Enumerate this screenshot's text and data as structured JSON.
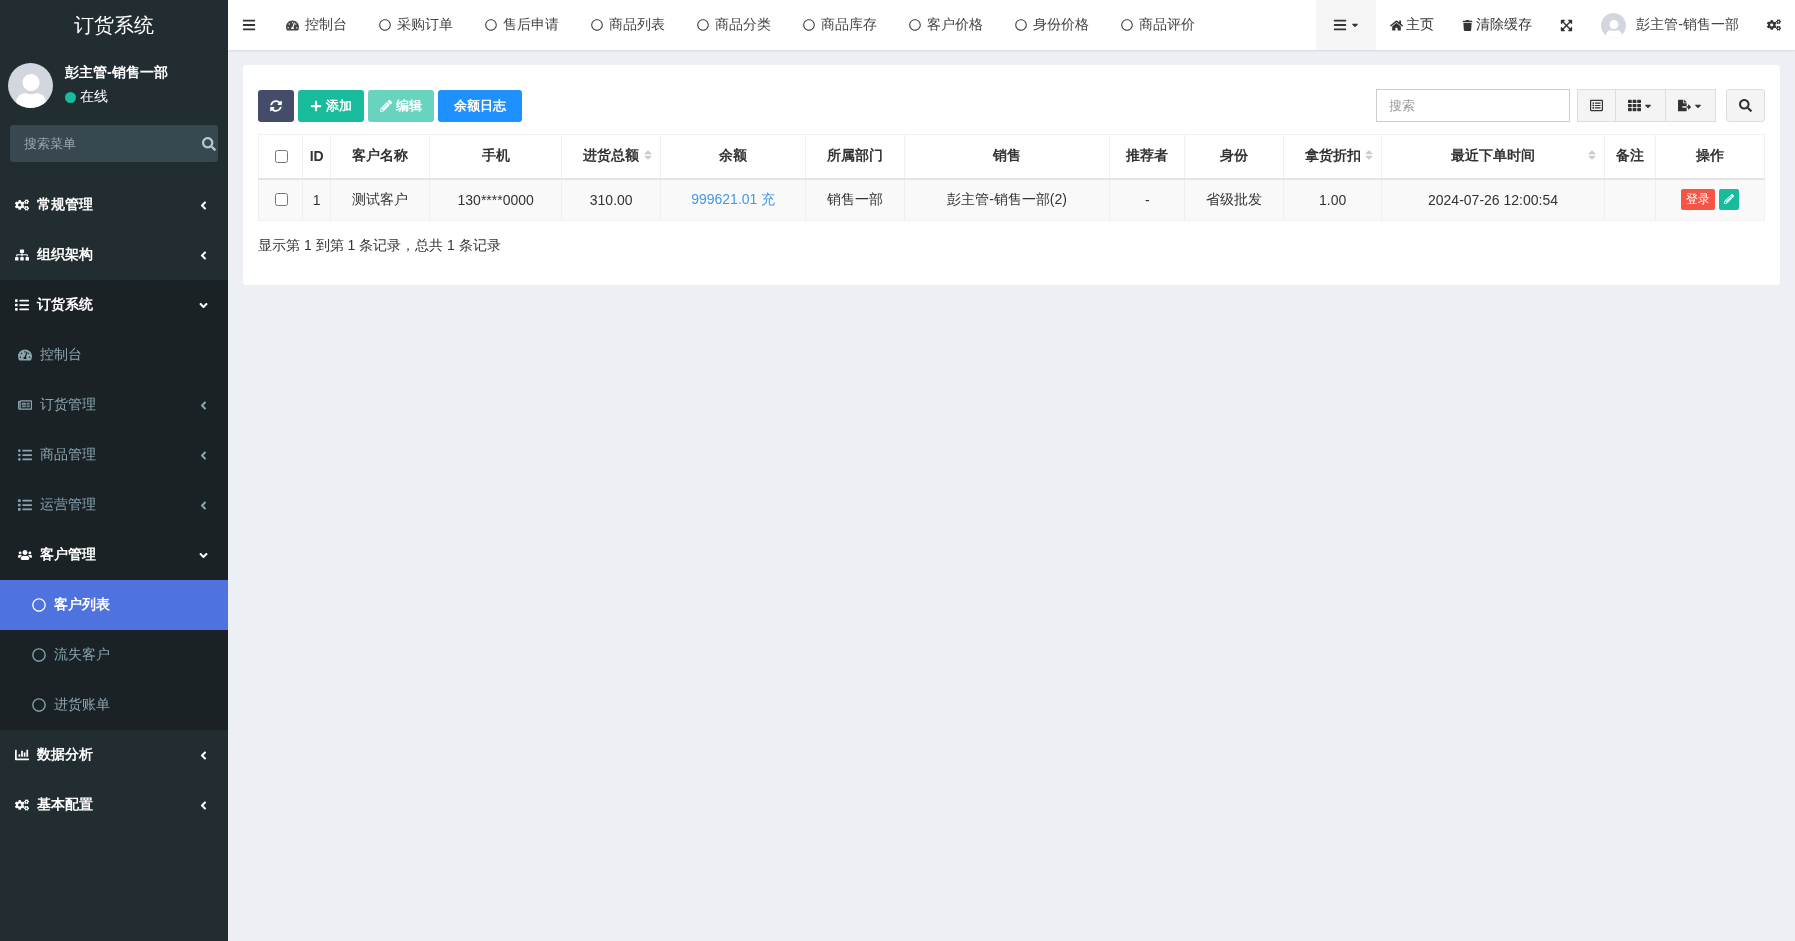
{
  "sidebar": {
    "title": "订货系统",
    "user": {
      "name": "彭主管-销售一部",
      "status": "在线",
      "online": true
    },
    "search": {
      "placeholder": "搜索菜单"
    },
    "menu": [
      {
        "label": "常规管理",
        "expanded": false
      },
      {
        "label": "组织架构",
        "expanded": false
      },
      {
        "label": "订货系统",
        "expanded": true,
        "children": [
          {
            "label": "控制台"
          },
          {
            "label": "订货管理",
            "expanded": false
          },
          {
            "label": "商品管理",
            "expanded": false
          },
          {
            "label": "运营管理",
            "expanded": false
          },
          {
            "label": "客户管理",
            "expanded": true,
            "children": [
              {
                "label": "客户列表",
                "selected": true
              },
              {
                "label": "流失客户",
                "selected": false
              },
              {
                "label": "进货账单",
                "selected": false
              }
            ]
          }
        ]
      },
      {
        "label": "数据分析",
        "expanded": false
      },
      {
        "label": "基本配置",
        "expanded": false
      }
    ]
  },
  "navbar": {
    "tabs": [
      {
        "label": "控制台",
        "kind": "dashboard"
      },
      {
        "label": "采购订单",
        "kind": "page"
      },
      {
        "label": "售后申请",
        "kind": "page"
      },
      {
        "label": "商品列表",
        "kind": "page"
      },
      {
        "label": "商品分类",
        "kind": "page"
      },
      {
        "label": "商品库存",
        "kind": "page"
      },
      {
        "label": "客户价格",
        "kind": "page"
      },
      {
        "label": "身份价格",
        "kind": "page"
      },
      {
        "label": "商品评价",
        "kind": "page"
      }
    ],
    "home": "主页",
    "clear_cache": "清除缓存",
    "user": "彭主管-销售一部"
  },
  "toolbar": {
    "buttons": [
      {
        "kind": "refresh",
        "disabled": false
      },
      {
        "kind": "add",
        "label": "添加",
        "disabled": false
      },
      {
        "kind": "edit",
        "label": "编辑",
        "disabled": true
      },
      {
        "kind": "log",
        "label": "余额日志",
        "disabled": false
      }
    ],
    "search": {
      "placeholder": "搜索"
    }
  },
  "table": {
    "header_checked": false,
    "columns": [
      {
        "label": "ID",
        "kind": "text",
        "sortable": false
      },
      {
        "label": "客户名称",
        "kind": "text",
        "sortable": false
      },
      {
        "label": "手机",
        "kind": "text",
        "sortable": false
      },
      {
        "label": "进货总额",
        "kind": "text",
        "sortable": true
      },
      {
        "label": "余额",
        "kind": "link",
        "sortable": false
      },
      {
        "label": "所属部门",
        "kind": "text",
        "sortable": false
      },
      {
        "label": "销售",
        "kind": "text",
        "sortable": false
      },
      {
        "label": "推荐者",
        "kind": "text",
        "sortable": false
      },
      {
        "label": "身份",
        "kind": "text",
        "sortable": false
      },
      {
        "label": "拿货折扣",
        "kind": "text",
        "sortable": true
      },
      {
        "label": "最近下单时间",
        "kind": "text",
        "sortable": true
      },
      {
        "label": "备注",
        "kind": "blank",
        "sortable": false
      },
      {
        "label": "操作",
        "kind": "actions",
        "sortable": false
      }
    ],
    "rows": [
      {
        "checked": false,
        "cells": [
          "1",
          "测试客户",
          "130****0000",
          "310.00",
          "999621.01 充",
          "销售一部",
          "彭主管-销售一部(2)",
          "-",
          "省级批发",
          "1.00",
          "2024-07-26 12:00:54"
        ],
        "actions": [
          {
            "kind": "login",
            "label": "登录"
          },
          {
            "kind": "edit"
          }
        ]
      }
    ],
    "footer": "显示第 1 到第 1 条记录，总共 1 条记录"
  }
}
